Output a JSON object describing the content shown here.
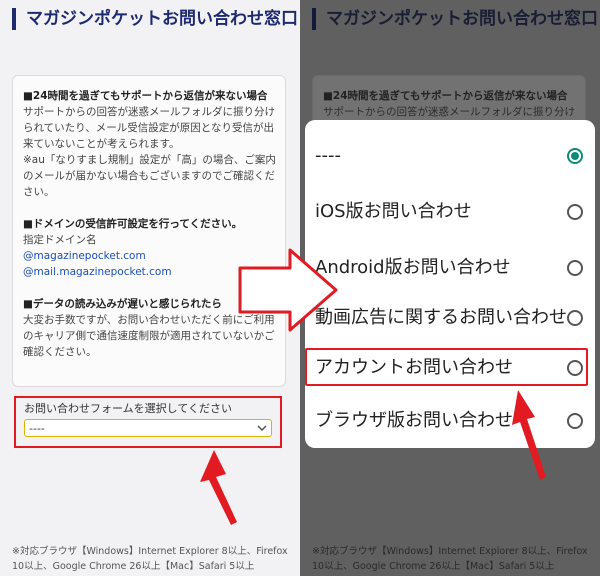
{
  "title": "マガジンポケットお問い合わせ窓口",
  "info": {
    "section1_heading": "■24時間を過ぎてもサポートから返信が来ない場合",
    "section1_body": "サポートからの回答が迷惑メールフォルダに振り分けられていたり、メール受信設定が原因となり受信が出来ていないことが考えられます。",
    "section1_note": "※au「なりすまし規制」設定が「高」の場合、ご案内のメールが届かない場合もございますのでご確認ください。",
    "section2_heading": "■ドメインの受信許可設定を行ってください。",
    "section2_label": "指定ドメイン名",
    "domain1": "@magazinepocket.com",
    "domain2": "@mail.magazinepocket.com",
    "section3_heading": "■データの読み込みが遅いと感じられたら",
    "section3_body": "大変お手数ですが、お問い合わせいただく前にご利用のキャリア側で通信速度制限が適用されていないかご確認ください。"
  },
  "form": {
    "label": "お問い合わせフォームを選択してください",
    "selected": "----"
  },
  "footer": "※対応ブラウザ【Windows】Internet Explorer 8以上、Firefox 10以上、Google Chrome 26以上【Mac】Safari 5以上",
  "dialog": {
    "options": [
      {
        "label": "----",
        "selected": true
      },
      {
        "label": "iOS版お問い合わせ",
        "selected": false
      },
      {
        "label": "Android版お問い合わせ",
        "selected": false
      },
      {
        "label": "動画広告に関するお問い合わせ",
        "selected": false
      },
      {
        "label": "アカウントお問い合わせ",
        "selected": false
      },
      {
        "label": "ブラウザ版お問い合わせ",
        "selected": false
      }
    ]
  },
  "colors": {
    "accent_navy": "#1d2a6f",
    "highlight_red": "#e21b22",
    "radio_teal": "#0e8a77",
    "select_border": "#e0b400"
  }
}
